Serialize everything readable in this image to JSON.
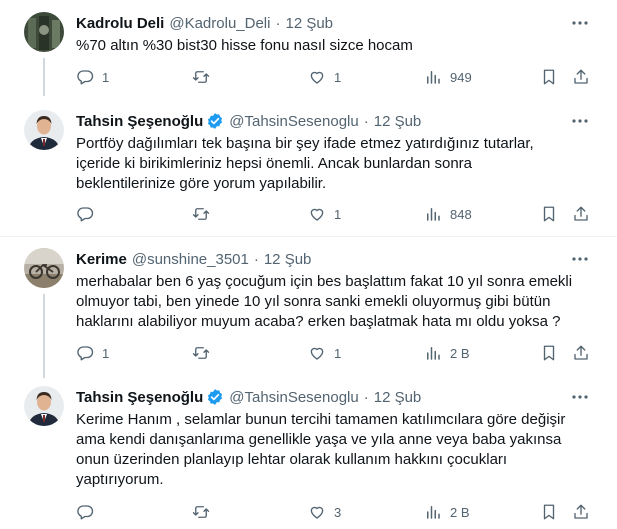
{
  "tweets": [
    {
      "name": "Kadrolu Deli",
      "handle": "@Kadrolu_Deli",
      "sep": "·",
      "date": "12 Şub",
      "verified": false,
      "lines": [
        "%70 altın %30 bist30 hisse fonu nasıl sizce hocam"
      ],
      "replies": "1",
      "retweets": "",
      "likes": "1",
      "views": "949"
    },
    {
      "name": "Tahsin Şeşenoğlu",
      "handle": "@TahsinSesenoglu",
      "sep": "·",
      "date": "12 Şub",
      "verified": true,
      "lines": [
        "Portföy dağılımları tek başına bir şey ifade etmez yatırdığınız tutarlar,",
        "içeride ki birikimleriniz hepsi önemli. Ancak bunlardan sonra",
        "beklentilerinize göre yorum yapılabilir."
      ],
      "replies": "",
      "retweets": "",
      "likes": "1",
      "views": "848"
    },
    {
      "name": "Kerime",
      "handle": "@sunshine_3501",
      "sep": "·",
      "date": "12 Şub",
      "verified": false,
      "lines": [
        "merhabalar ben 6 yaş çocuğum için bes başlattım fakat 10 yıl sonra emekli",
        "olmuyor tabi, ben yinede 10 yıl sonra sanki emekli oluyormuş gibi bütün",
        "haklarını alabiliyor muyum acaba? erken başlatmak hata mı oldu yoksa ?"
      ],
      "replies": "1",
      "retweets": "",
      "likes": "1",
      "views": "2 B"
    },
    {
      "name": "Tahsin Şeşenoğlu",
      "handle": "@TahsinSesenoglu",
      "sep": "·",
      "date": "12 Şub",
      "verified": true,
      "lines": [
        "Kerime Hanım , selamlar bunun tercihi tamamen katılımcılara göre değişir",
        "ama kendi danışanlarıma genellikle yaşa ve yıla anne veya baba yakınsa",
        "onun üzerinden planlayıp lehtar olarak kullanım hakkını çocukları",
        "yaptırıyorum."
      ],
      "replies": "",
      "retweets": "",
      "likes": "3",
      "views": "2 B"
    }
  ],
  "colors": {
    "text": "#0f1419",
    "muted": "#536471",
    "verified": "#1d9bf0",
    "divider": "#eff3f4",
    "thread": "#cfd9de"
  },
  "icons": {
    "reply": "reply-icon",
    "retweet": "retweet-icon",
    "like": "heart-icon",
    "views": "views-icon",
    "bookmark": "bookmark-icon",
    "share": "share-icon",
    "more": "more-icon",
    "verified": "verified-badge-icon"
  }
}
